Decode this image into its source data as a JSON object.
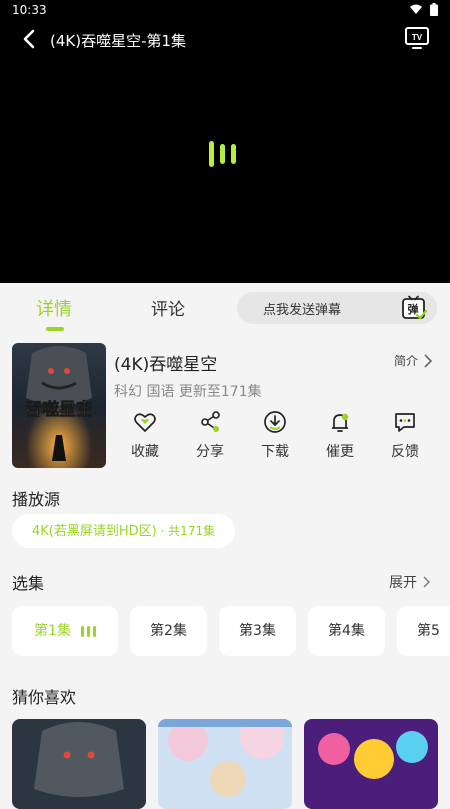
{
  "status": {
    "time": "10:33"
  },
  "player": {
    "title": "(4K)吞噬星空-第1集"
  },
  "tabs": {
    "detail": "详情",
    "comments": "评论"
  },
  "danmu": {
    "placeholder": "点我发送弹幕",
    "icon_text": "弹"
  },
  "show": {
    "title": "(4K)吞噬星空",
    "synopsis_label": "简介",
    "meta": "科幻 国语 更新至171集",
    "poster_text": "吞噬星空"
  },
  "actions": [
    {
      "label": "收藏",
      "icon": "heart-icon"
    },
    {
      "label": "分享",
      "icon": "share-icon"
    },
    {
      "label": "下载",
      "icon": "download-icon"
    },
    {
      "label": "催更",
      "icon": "bell-icon"
    },
    {
      "label": "反馈",
      "icon": "feedback-icon"
    }
  ],
  "source": {
    "heading": "播放源",
    "name": "4K(若黑屏请到HD区)",
    "count": " · 共171集"
  },
  "episodes": {
    "heading": "选集",
    "expand_label": "展开",
    "items": [
      "第1集",
      "第2集",
      "第3集",
      "第4集",
      "第5"
    ]
  },
  "recommend": {
    "heading": "猜你喜欢"
  },
  "colors": {
    "accent": "#9ad524",
    "loading": "#b4f03c",
    "background": "#f4f4f4"
  }
}
